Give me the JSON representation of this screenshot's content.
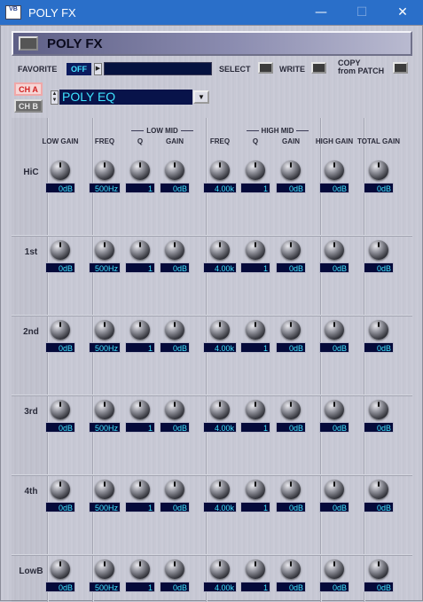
{
  "window": {
    "title": "POLY FX",
    "icon_text": "VB",
    "minimize": "—",
    "maximize": "☐",
    "close": "✕"
  },
  "header": {
    "title": "POLY FX"
  },
  "toolbar": {
    "favorite_label": "FAVORITE",
    "favorite_value": "OFF",
    "select_label": "SELECT",
    "write_label": "WRITE",
    "copy_label_line1": "COPY",
    "copy_label_line2": "from PATCH"
  },
  "channels": {
    "a": "CH A",
    "b": "CH B",
    "active": "CH A"
  },
  "fx_type": {
    "value": "POLY EQ"
  },
  "groups": {
    "low_mid": "LOW MID",
    "high_mid": "HIGH MID"
  },
  "columns": [
    "LOW GAIN",
    "FREQ",
    "Q",
    "GAIN",
    "FREQ",
    "Q",
    "GAIN",
    "HIGH GAIN",
    "TOTAL GAIN"
  ],
  "rows": [
    {
      "label": "HiC",
      "values": [
        "0dB",
        "500Hz",
        "1",
        "0dB",
        "4.00k",
        "1",
        "0dB",
        "0dB",
        "0dB"
      ]
    },
    {
      "label": "1st",
      "values": [
        "0dB",
        "500Hz",
        "1",
        "0dB",
        "4.00k",
        "1",
        "0dB",
        "0dB",
        "0dB"
      ]
    },
    {
      "label": "2nd",
      "values": [
        "0dB",
        "500Hz",
        "1",
        "0dB",
        "4.00k",
        "1",
        "0dB",
        "0dB",
        "0dB"
      ]
    },
    {
      "label": "3rd",
      "values": [
        "0dB",
        "500Hz",
        "1",
        "0dB",
        "4.00k",
        "1",
        "0dB",
        "0dB",
        "0dB"
      ]
    },
    {
      "label": "4th",
      "values": [
        "0dB",
        "500Hz",
        "1",
        "0dB",
        "4.00k",
        "1",
        "0dB",
        "0dB",
        "0dB"
      ]
    },
    {
      "label": "LowB",
      "values": [
        "0dB",
        "500Hz",
        "1",
        "0dB",
        "4.00k",
        "1",
        "0dB",
        "0dB",
        "0dB"
      ]
    }
  ]
}
